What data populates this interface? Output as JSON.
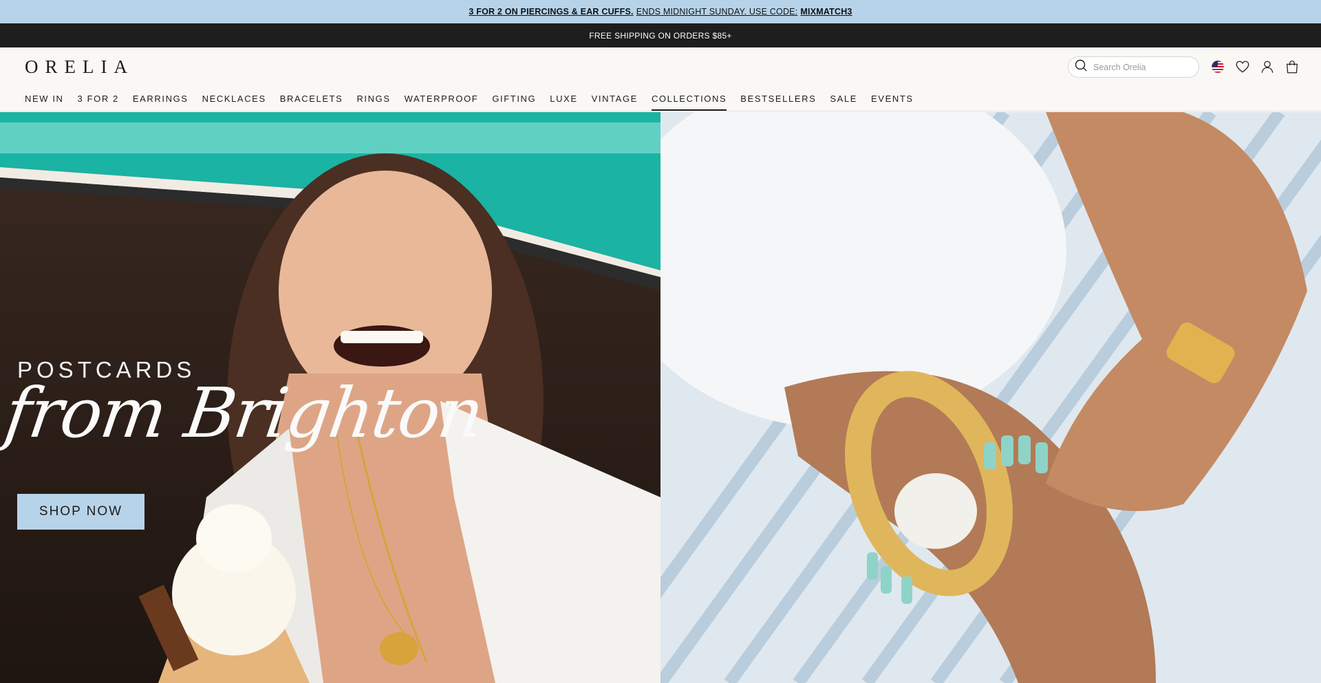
{
  "promo": {
    "bold_text": "3 FOR 2 ON PIERCINGS & EAR CUFFS.",
    "text": "ENDS MIDNIGHT SUNDAY. USE CODE:",
    "code": "MIXMATCH3"
  },
  "shipping": {
    "text": "FREE SHIPPING ON ORDERS $85+"
  },
  "header": {
    "logo": "ORELIA",
    "search_placeholder": "Search Orelia",
    "icons": [
      "search-icon",
      "us-flag-icon",
      "heart-icon",
      "user-icon",
      "bag-icon"
    ]
  },
  "nav": {
    "items": [
      {
        "label": "NEW IN"
      },
      {
        "label": "3 FOR 2"
      },
      {
        "label": "EARRINGS"
      },
      {
        "label": "NECKLACES"
      },
      {
        "label": "BRACELETS"
      },
      {
        "label": "RINGS"
      },
      {
        "label": "WATERPROOF"
      },
      {
        "label": "GIFTING"
      },
      {
        "label": "LUXE"
      },
      {
        "label": "VINTAGE"
      },
      {
        "label": "COLLECTIONS",
        "active": true
      },
      {
        "label": "BESTSELLERS"
      },
      {
        "label": "SALE"
      },
      {
        "label": "EVENTS"
      }
    ]
  },
  "hero": {
    "headline_top": "POSTCARDS",
    "headline_script": "from Brighton",
    "cta_label": "SHOP NOW"
  },
  "colors": {
    "promo_bg": "#b7d3e9",
    "ship_bg": "#1e1e1e",
    "header_bg": "#faf8f4",
    "cta_bg": "#b7d3e9"
  }
}
